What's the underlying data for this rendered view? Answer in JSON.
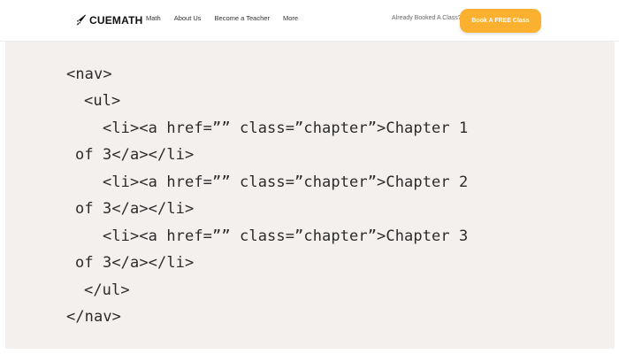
{
  "header": {
    "logo_text": "CUEMATH",
    "logo_icon": "rocket-icon",
    "nav": [
      {
        "label": "Math"
      },
      {
        "label": "About Us"
      },
      {
        "label": "Become a Teacher"
      },
      {
        "label": "More"
      }
    ],
    "booked_text": "Already Booked A Class?",
    "cta_label": "Book A FREE Class",
    "cta_color": "#fbb12f"
  },
  "code": {
    "background": "#f4f0ee",
    "lines": [
      "<nav>",
      "<ul>",
      "<li><a href=”” class=”chapter”>Chapter 1",
      "of 3</a></li>",
      "<li><a href=”” class=”chapter”>Chapter 2",
      "of 3</a></li>",
      "<li><a href=”” class=”chapter”>Chapter 3",
      "of 3</a></li>",
      "</ul>",
      "</nav>"
    ]
  }
}
